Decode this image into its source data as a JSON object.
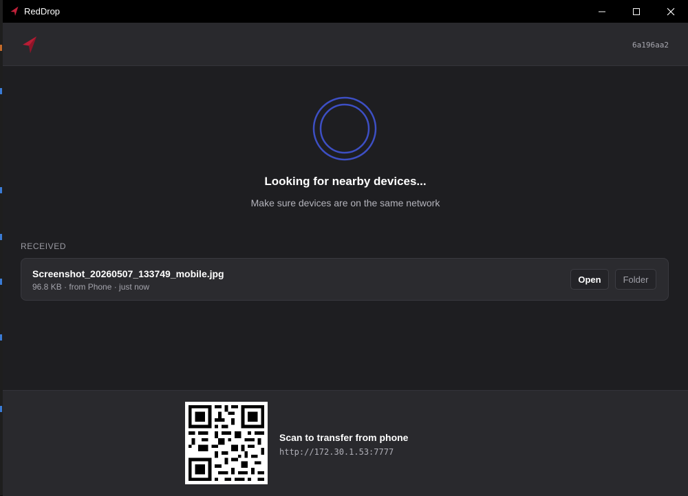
{
  "window": {
    "title": "RedDrop",
    "icons": {
      "app": "reddrop-logo-icon",
      "minimize": "minimize-icon",
      "maximize": "maximize-icon",
      "close": "close-icon"
    }
  },
  "header": {
    "logo_icon": "reddrop-logo-icon",
    "device_id": "6a196aa2"
  },
  "discovery": {
    "icon": "radar-icon",
    "title": "Looking for nearby devices...",
    "subtitle": "Make sure devices are on the same network"
  },
  "received": {
    "section_label": "RECEIVED",
    "files": [
      {
        "name": "Screenshot_20260507_133749_mobile.jpg",
        "meta": "96.8 KB · from Phone · just now",
        "open_label": "Open",
        "folder_label": "Folder"
      }
    ]
  },
  "footer": {
    "qr_icon": "qr-code-icon",
    "scan_title": "Scan to transfer from phone",
    "url": "http://172.30.1.53:7777"
  },
  "colors": {
    "accent_red": "#c1213a",
    "radar_blue": "#3d4fc4",
    "background": "#1e1e21",
    "panel": "#29292d"
  }
}
